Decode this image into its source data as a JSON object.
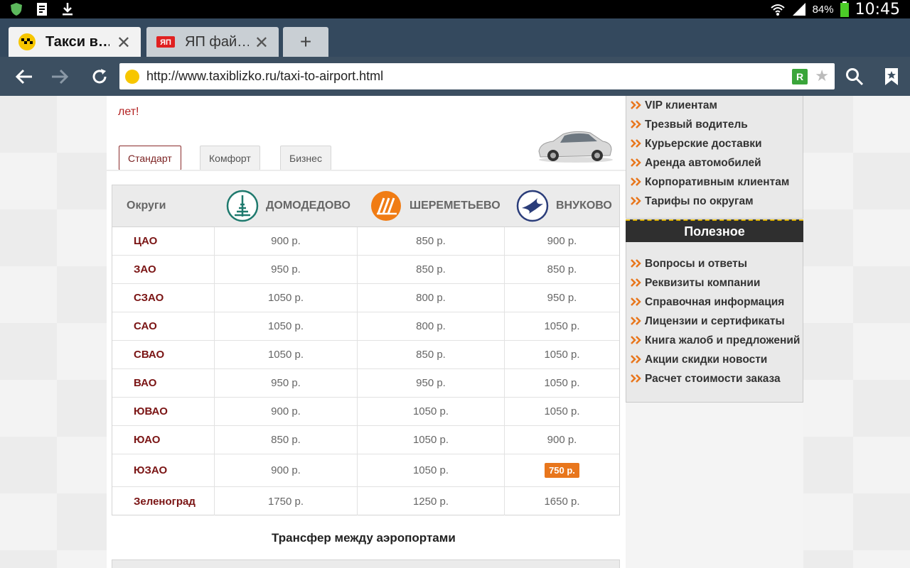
{
  "status_bar": {
    "battery": "84%",
    "time": "10:45"
  },
  "tabs": [
    {
      "title": "Такси в…",
      "active": true,
      "icon": "taxi-icon"
    },
    {
      "title": "ЯП фай…",
      "active": false,
      "icon": "yap-icon"
    }
  ],
  "address_bar": {
    "url": "http://www.taxiblizko.ru/taxi-to-airport.html"
  },
  "intro": {
    "line2": "лет!"
  },
  "classes": [
    "Стандарт",
    "Комфорт",
    "Бизнес"
  ],
  "table": {
    "header": {
      "districts": "Округи",
      "airports": [
        "ДОМОДЕДОВО",
        "ШЕРЕМЕТЬЕВО",
        "ВНУКОВО"
      ]
    },
    "rows": [
      {
        "district": "ЦАО",
        "prices": [
          "900 р.",
          "850 р.",
          "900 р."
        ]
      },
      {
        "district": "ЗАО",
        "prices": [
          "950 р.",
          "850 р.",
          "850 р."
        ]
      },
      {
        "district": "СЗАО",
        "prices": [
          "1050 р.",
          "800 р.",
          "950 р."
        ]
      },
      {
        "district": "САО",
        "prices": [
          "1050 р.",
          "800 р.",
          "1050 р."
        ]
      },
      {
        "district": "СВАО",
        "prices": [
          "1050 р.",
          "850 р.",
          "1050 р."
        ]
      },
      {
        "district": "ВАО",
        "prices": [
          "950 р.",
          "950 р.",
          "1050 р."
        ]
      },
      {
        "district": "ЮВАО",
        "prices": [
          "900 р.",
          "1050 р.",
          "1050 р."
        ]
      },
      {
        "district": "ЮАО",
        "prices": [
          "850 р.",
          "1050 р.",
          "900 р."
        ]
      },
      {
        "district": "ЮЗАО",
        "prices": [
          "900 р.",
          "1050 р.",
          "750 р."
        ]
      },
      {
        "district": "Зеленоград",
        "prices": [
          "1750 р.",
          "1250 р.",
          "1650 р."
        ]
      }
    ]
  },
  "transfer_title": "Трансфер между аэропортами",
  "sidebar": {
    "services": [
      "VIP клиентам",
      "Трезвый водитель",
      "Курьерские доставки",
      "Аренда автомобилей",
      "Корпоративным клиентам",
      "Тарифы по округам"
    ],
    "useful_title": "Полезное",
    "useful": [
      "Вопросы и ответы",
      "Реквизиты компании",
      "Справочная информация",
      "Лицензии и сертификаты",
      "Книга жалоб и предложений",
      "Акции скидки новости",
      "Расчет стоимости заказа"
    ]
  },
  "colors": {
    "accent": "#7a1414",
    "highlight": "#e8761c",
    "chrome": "#3c4f61"
  }
}
